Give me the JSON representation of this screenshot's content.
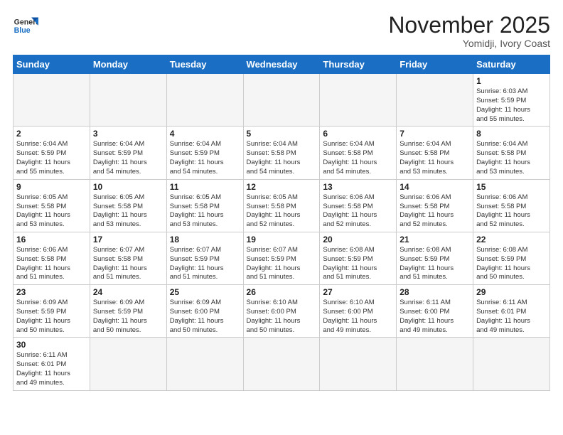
{
  "header": {
    "logo_general": "General",
    "logo_blue": "Blue",
    "month_title": "November 2025",
    "location": "Yomidji, Ivory Coast"
  },
  "weekdays": [
    "Sunday",
    "Monday",
    "Tuesday",
    "Wednesday",
    "Thursday",
    "Friday",
    "Saturday"
  ],
  "days": [
    {
      "num": "",
      "info": ""
    },
    {
      "num": "",
      "info": ""
    },
    {
      "num": "",
      "info": ""
    },
    {
      "num": "",
      "info": ""
    },
    {
      "num": "",
      "info": ""
    },
    {
      "num": "",
      "info": ""
    },
    {
      "num": "1",
      "info": "Sunrise: 6:03 AM\nSunset: 5:59 PM\nDaylight: 11 hours\nand 55 minutes."
    },
    {
      "num": "2",
      "info": "Sunrise: 6:04 AM\nSunset: 5:59 PM\nDaylight: 11 hours\nand 55 minutes."
    },
    {
      "num": "3",
      "info": "Sunrise: 6:04 AM\nSunset: 5:59 PM\nDaylight: 11 hours\nand 54 minutes."
    },
    {
      "num": "4",
      "info": "Sunrise: 6:04 AM\nSunset: 5:59 PM\nDaylight: 11 hours\nand 54 minutes."
    },
    {
      "num": "5",
      "info": "Sunrise: 6:04 AM\nSunset: 5:58 PM\nDaylight: 11 hours\nand 54 minutes."
    },
    {
      "num": "6",
      "info": "Sunrise: 6:04 AM\nSunset: 5:58 PM\nDaylight: 11 hours\nand 54 minutes."
    },
    {
      "num": "7",
      "info": "Sunrise: 6:04 AM\nSunset: 5:58 PM\nDaylight: 11 hours\nand 53 minutes."
    },
    {
      "num": "8",
      "info": "Sunrise: 6:04 AM\nSunset: 5:58 PM\nDaylight: 11 hours\nand 53 minutes."
    },
    {
      "num": "9",
      "info": "Sunrise: 6:05 AM\nSunset: 5:58 PM\nDaylight: 11 hours\nand 53 minutes."
    },
    {
      "num": "10",
      "info": "Sunrise: 6:05 AM\nSunset: 5:58 PM\nDaylight: 11 hours\nand 53 minutes."
    },
    {
      "num": "11",
      "info": "Sunrise: 6:05 AM\nSunset: 5:58 PM\nDaylight: 11 hours\nand 53 minutes."
    },
    {
      "num": "12",
      "info": "Sunrise: 6:05 AM\nSunset: 5:58 PM\nDaylight: 11 hours\nand 52 minutes."
    },
    {
      "num": "13",
      "info": "Sunrise: 6:06 AM\nSunset: 5:58 PM\nDaylight: 11 hours\nand 52 minutes."
    },
    {
      "num": "14",
      "info": "Sunrise: 6:06 AM\nSunset: 5:58 PM\nDaylight: 11 hours\nand 52 minutes."
    },
    {
      "num": "15",
      "info": "Sunrise: 6:06 AM\nSunset: 5:58 PM\nDaylight: 11 hours\nand 52 minutes."
    },
    {
      "num": "16",
      "info": "Sunrise: 6:06 AM\nSunset: 5:58 PM\nDaylight: 11 hours\nand 51 minutes."
    },
    {
      "num": "17",
      "info": "Sunrise: 6:07 AM\nSunset: 5:58 PM\nDaylight: 11 hours\nand 51 minutes."
    },
    {
      "num": "18",
      "info": "Sunrise: 6:07 AM\nSunset: 5:59 PM\nDaylight: 11 hours\nand 51 minutes."
    },
    {
      "num": "19",
      "info": "Sunrise: 6:07 AM\nSunset: 5:59 PM\nDaylight: 11 hours\nand 51 minutes."
    },
    {
      "num": "20",
      "info": "Sunrise: 6:08 AM\nSunset: 5:59 PM\nDaylight: 11 hours\nand 51 minutes."
    },
    {
      "num": "21",
      "info": "Sunrise: 6:08 AM\nSunset: 5:59 PM\nDaylight: 11 hours\nand 51 minutes."
    },
    {
      "num": "22",
      "info": "Sunrise: 6:08 AM\nSunset: 5:59 PM\nDaylight: 11 hours\nand 50 minutes."
    },
    {
      "num": "23",
      "info": "Sunrise: 6:09 AM\nSunset: 5:59 PM\nDaylight: 11 hours\nand 50 minutes."
    },
    {
      "num": "24",
      "info": "Sunrise: 6:09 AM\nSunset: 5:59 PM\nDaylight: 11 hours\nand 50 minutes."
    },
    {
      "num": "25",
      "info": "Sunrise: 6:09 AM\nSunset: 6:00 PM\nDaylight: 11 hours\nand 50 minutes."
    },
    {
      "num": "26",
      "info": "Sunrise: 6:10 AM\nSunset: 6:00 PM\nDaylight: 11 hours\nand 50 minutes."
    },
    {
      "num": "27",
      "info": "Sunrise: 6:10 AM\nSunset: 6:00 PM\nDaylight: 11 hours\nand 49 minutes."
    },
    {
      "num": "28",
      "info": "Sunrise: 6:11 AM\nSunset: 6:00 PM\nDaylight: 11 hours\nand 49 minutes."
    },
    {
      "num": "29",
      "info": "Sunrise: 6:11 AM\nSunset: 6:01 PM\nDaylight: 11 hours\nand 49 minutes."
    },
    {
      "num": "30",
      "info": "Sunrise: 6:11 AM\nSunset: 6:01 PM\nDaylight: 11 hours\nand 49 minutes."
    },
    {
      "num": "",
      "info": ""
    },
    {
      "num": "",
      "info": ""
    },
    {
      "num": "",
      "info": ""
    },
    {
      "num": "",
      "info": ""
    },
    {
      "num": "",
      "info": ""
    },
    {
      "num": "",
      "info": ""
    }
  ]
}
